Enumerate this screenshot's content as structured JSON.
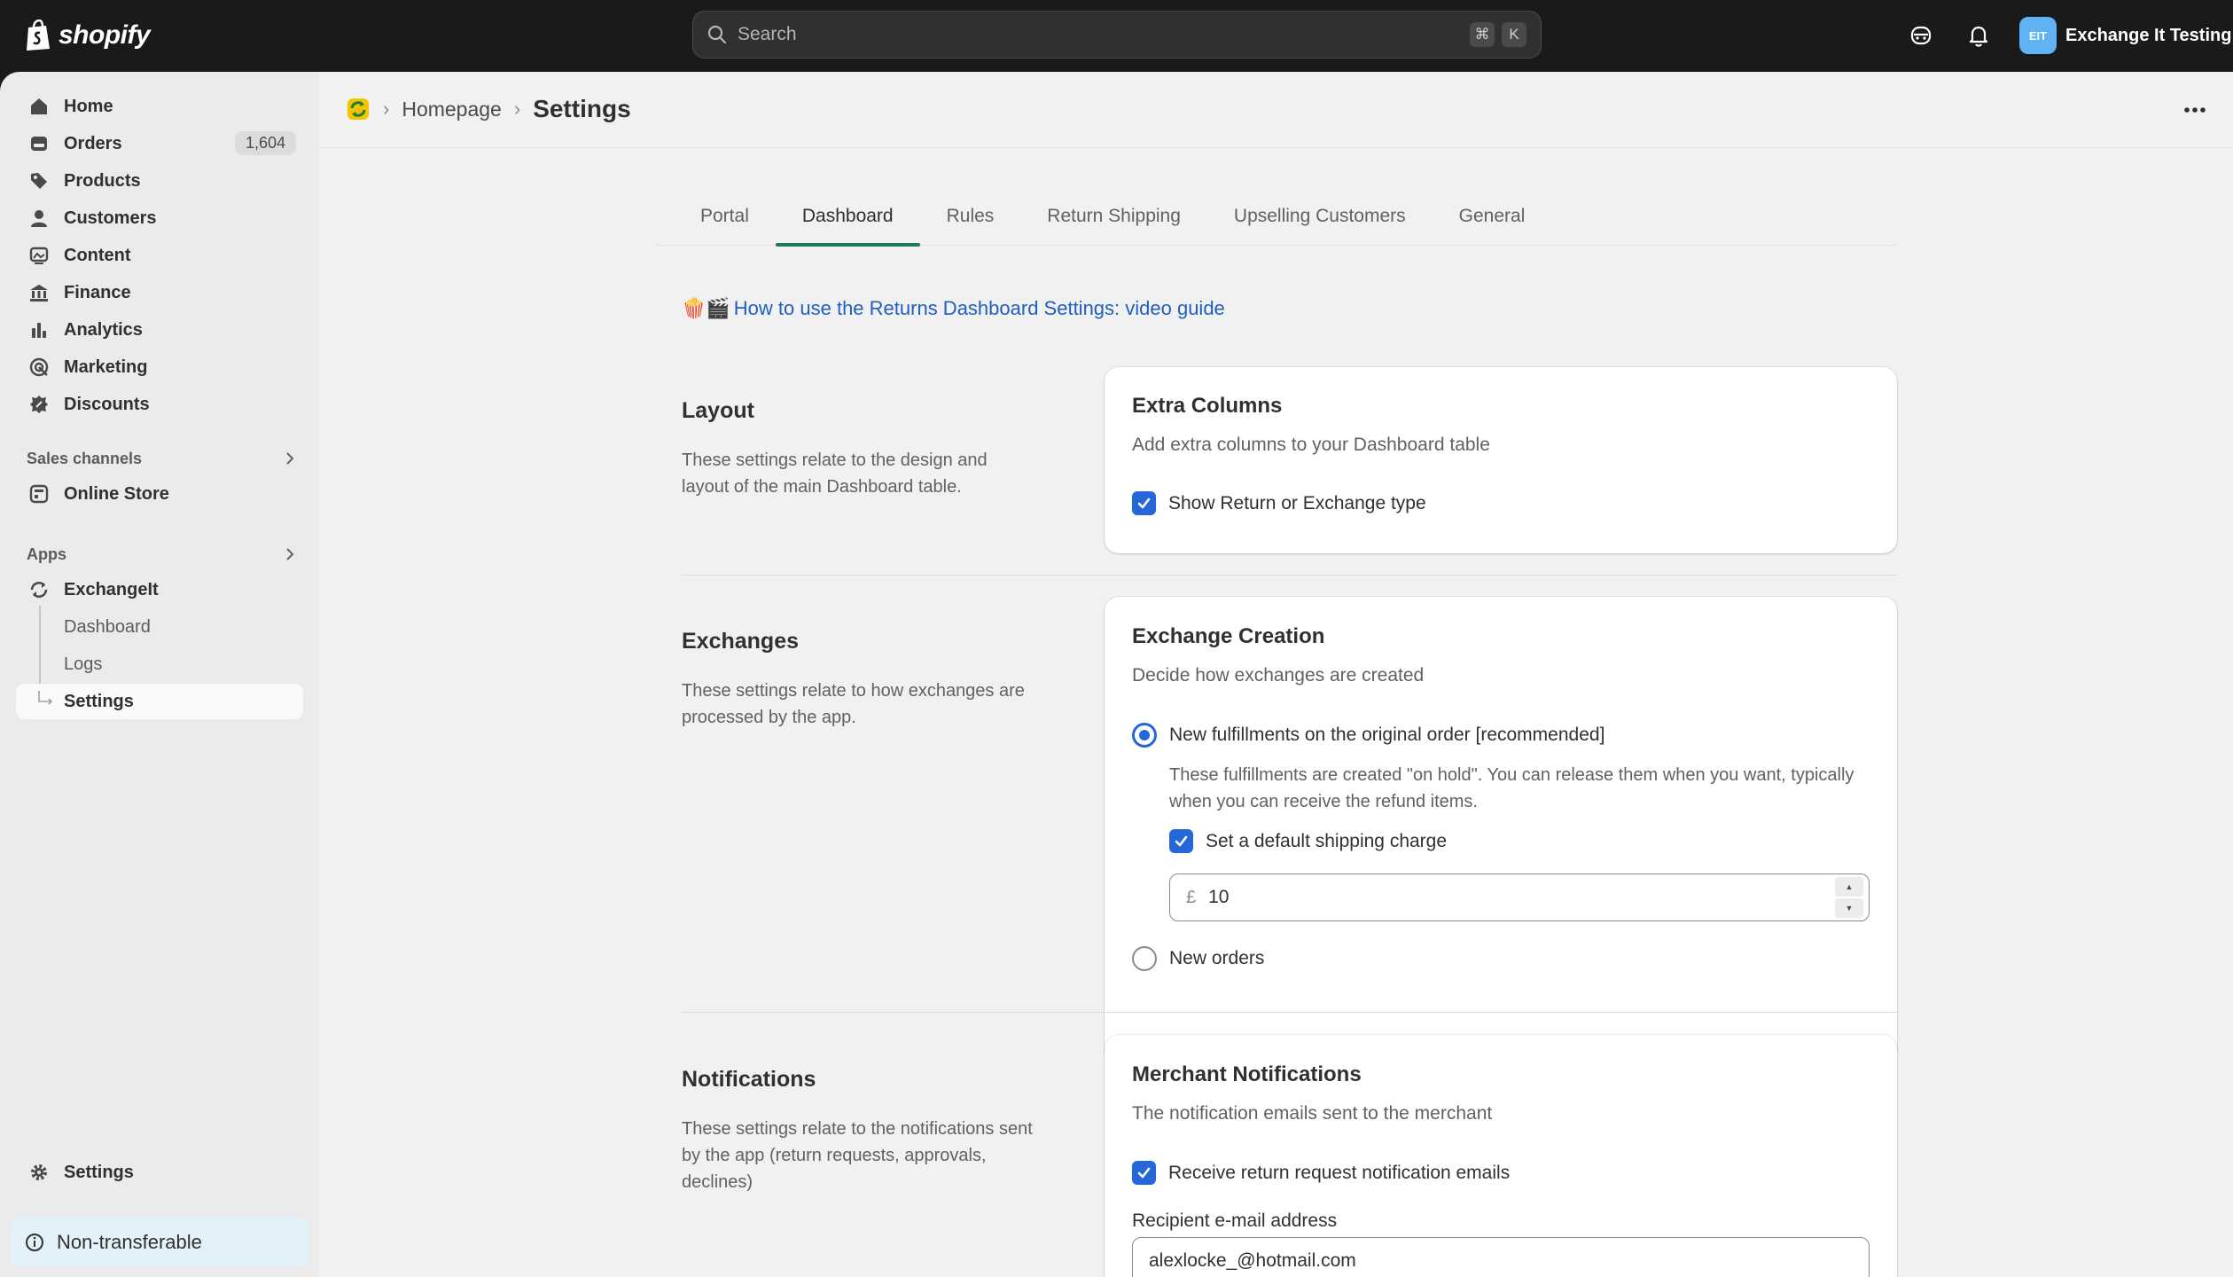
{
  "topbar": {
    "brand": "shopify",
    "search_placeholder": "Search",
    "shortcut_keys": [
      "⌘",
      "K"
    ],
    "store_initials": "EIT",
    "store_name": "Exchange It Testing"
  },
  "sidebar": {
    "items": [
      {
        "label": "Home",
        "icon": "home-icon"
      },
      {
        "label": "Orders",
        "icon": "orders-icon",
        "badge": "1,604"
      },
      {
        "label": "Products",
        "icon": "tag-icon"
      },
      {
        "label": "Customers",
        "icon": "person-icon"
      },
      {
        "label": "Content",
        "icon": "content-icon"
      },
      {
        "label": "Finance",
        "icon": "bank-icon"
      },
      {
        "label": "Analytics",
        "icon": "bar-chart-icon"
      },
      {
        "label": "Marketing",
        "icon": "target-icon"
      },
      {
        "label": "Discounts",
        "icon": "discount-icon"
      }
    ],
    "sales_channels_label": "Sales channels",
    "online_store_label": "Online Store",
    "apps_label": "Apps",
    "app_name": "ExchangeIt",
    "app_subitems": [
      "Dashboard",
      "Logs",
      "Settings"
    ],
    "settings_label": "Settings",
    "non_transferable_label": "Non-transferable"
  },
  "header": {
    "breadcrumb_home": "Homepage",
    "title": "Settings"
  },
  "tabs": [
    "Portal",
    "Dashboard",
    "Rules",
    "Return Shipping",
    "Upselling Customers",
    "General"
  ],
  "active_tab": "Dashboard",
  "guide": {
    "emoji": "🍿🎬",
    "link": "How to use the Returns Dashboard Settings: video guide"
  },
  "sections": {
    "layout": {
      "title": "Layout",
      "desc": "These settings relate to the design and layout of the main Dashboard table.",
      "card_title": "Extra Columns",
      "card_sub": "Add extra columns to your Dashboard table",
      "checkbox_label": "Show Return or Exchange type"
    },
    "exchanges": {
      "title": "Exchanges",
      "desc": "These settings relate to how exchanges are processed by the app.",
      "card_title": "Exchange Creation",
      "card_sub": "Decide how exchanges are created",
      "option_1": "New fulfillments on the original order [recommended]",
      "option_1_help": "These fulfillments are created \"on hold\". You can release them when you want, typically when you can receive the refund items.",
      "shipping_checkbox": "Set a default shipping charge",
      "currency": "£",
      "shipping_value": "10",
      "option_2": "New orders"
    },
    "notifications": {
      "title": "Notifications",
      "desc": "These settings relate to the notifications sent by the app (return requests, approvals, declines)",
      "card_title": "Merchant Notifications",
      "card_sub": "The notification emails sent to the merchant",
      "checkbox_label": "Receive return request notification emails",
      "email_label": "Recipient e-mail address",
      "email_value": "alexlocke_@hotmail.com"
    }
  },
  "colors": {
    "accent": "#2567d8",
    "tab_underline": "#1e7a5a",
    "link": "#1f5fbf"
  }
}
